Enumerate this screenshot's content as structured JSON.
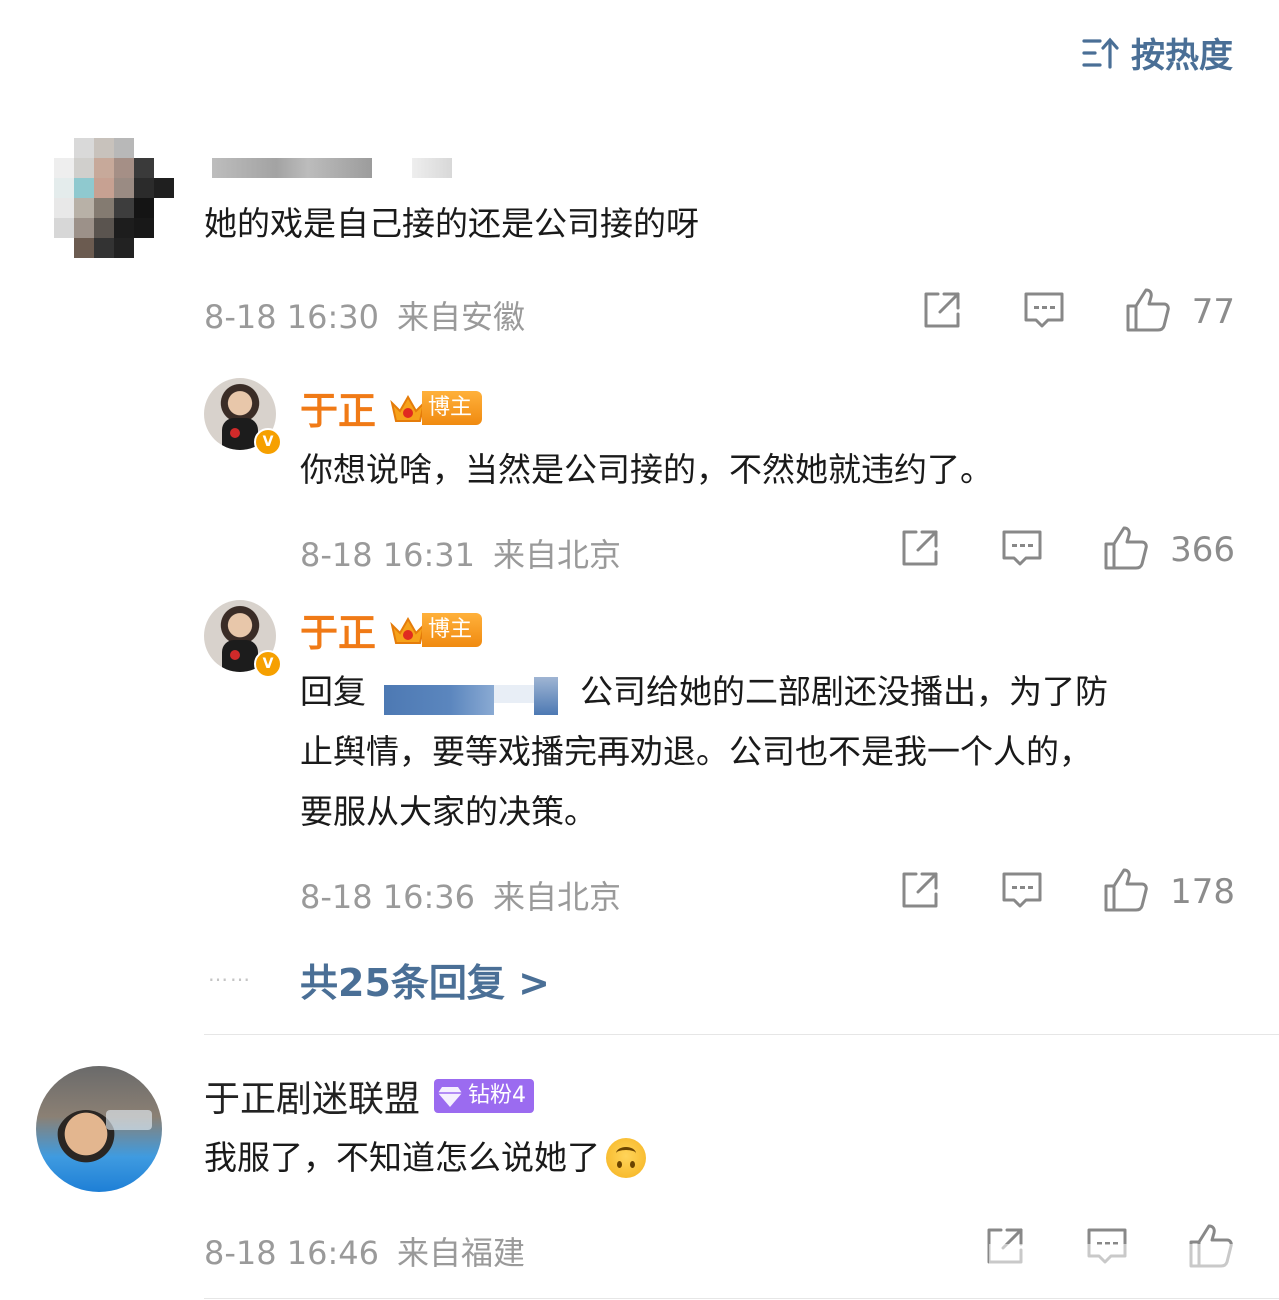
{
  "sort": {
    "label": "按热度"
  },
  "comments": [
    {
      "text": "她的戏是自己接的还是公司接的呀",
      "time": "8-18 16:30",
      "location": "来自安徽",
      "likes": "77"
    }
  ],
  "replies": [
    {
      "username": "于正",
      "badge": "博主",
      "text": "你想说啥，当然是公司接的，不然她就违约了。",
      "time": "8-18 16:31",
      "location": "来自北京",
      "likes": "366"
    },
    {
      "username": "于正",
      "badge": "博主",
      "reply_prefix": "回复",
      "text_line1": "公司给她的二部剧还没播出，为了防",
      "text_line2": "止舆情，要等戏播完再劝退。公司也不是我一个人的，",
      "text_line3": "要服从大家的决策。",
      "time": "8-18 16:36",
      "location": "来自北京",
      "likes": "178"
    }
  ],
  "more_replies": {
    "dots": "……",
    "label": "共25条回复 >"
  },
  "comment2": {
    "username": "于正剧迷联盟",
    "badge": "钻粉4",
    "text": "我服了，不知道怎么说她了",
    "time": "8-18 16:46",
    "location": "来自福建"
  },
  "colors": {
    "link_blue": "#4a6f96",
    "username_orange": "#f07a16",
    "meta_gray": "#9a9a9a",
    "fan_purple": "#9b6bf0"
  }
}
